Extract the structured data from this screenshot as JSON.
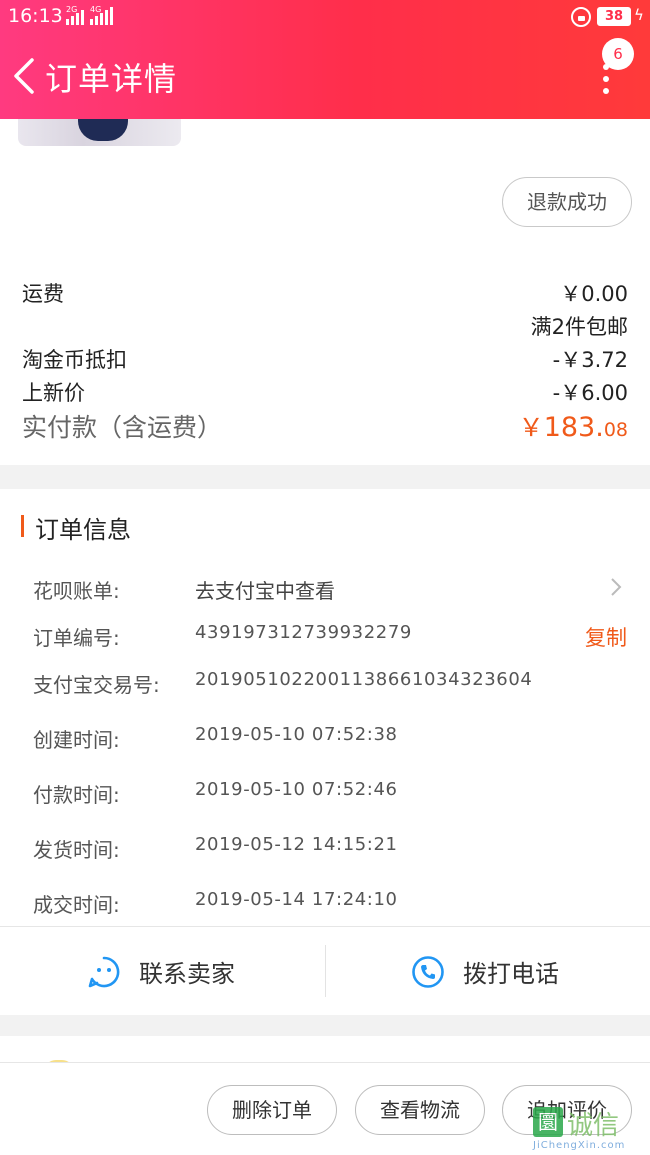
{
  "status_bar": {
    "time": "16:13",
    "net1": "2G",
    "net2": "4G",
    "battery": "38"
  },
  "header": {
    "title": "订单详情",
    "notification_count": "6"
  },
  "product": {
    "refund_status": "退款成功"
  },
  "fees": {
    "shipping_label": "运费",
    "shipping_value": "￥0.00",
    "shipping_note": "满2件包邮",
    "coin_label": "淘金币抵扣",
    "coin_value": "-￥3.72",
    "new_price_label": "上新价",
    "new_price_value": "-￥6.00",
    "paid_label": "实付款（含运费）",
    "paid_currency": "￥",
    "paid_int": "183.",
    "paid_dec": "08"
  },
  "order_info": {
    "section_title": "订单信息",
    "huabei_label": "花呗账单:",
    "huabei_value": "去支付宝中查看",
    "order_no_label": "订单编号:",
    "order_no": "439197312739932279",
    "copy_label": "复制",
    "alipay_label": "支付宝交易号:",
    "alipay_no": "2019051022001138661034323604",
    "created_label": "创建时间:",
    "created": "2019-05-10 07:52:38",
    "paid_label": "付款时间:",
    "paid": "2019-05-10 07:52:46",
    "shipped_label": "发货时间:",
    "shipped": "2019-05-12 14:15:21",
    "completed_label": "成交时间:",
    "completed": "2019-05-14 17:24:10"
  },
  "contact": {
    "seller_label": "联系卖家",
    "phone_label": "拨打电话"
  },
  "actions": {
    "delete_label": "删除订单",
    "logistics_label": "查看物流",
    "review_label": "追加评价"
  },
  "watermark": {
    "logo_char": "圜",
    "cn": "诚信",
    "en": "JiChengXin.com"
  },
  "colors": {
    "accent": "#f05a1a",
    "header_start": "#ff3a80",
    "header_end": "#ff2e4a",
    "contact_icon": "#2196f3"
  }
}
